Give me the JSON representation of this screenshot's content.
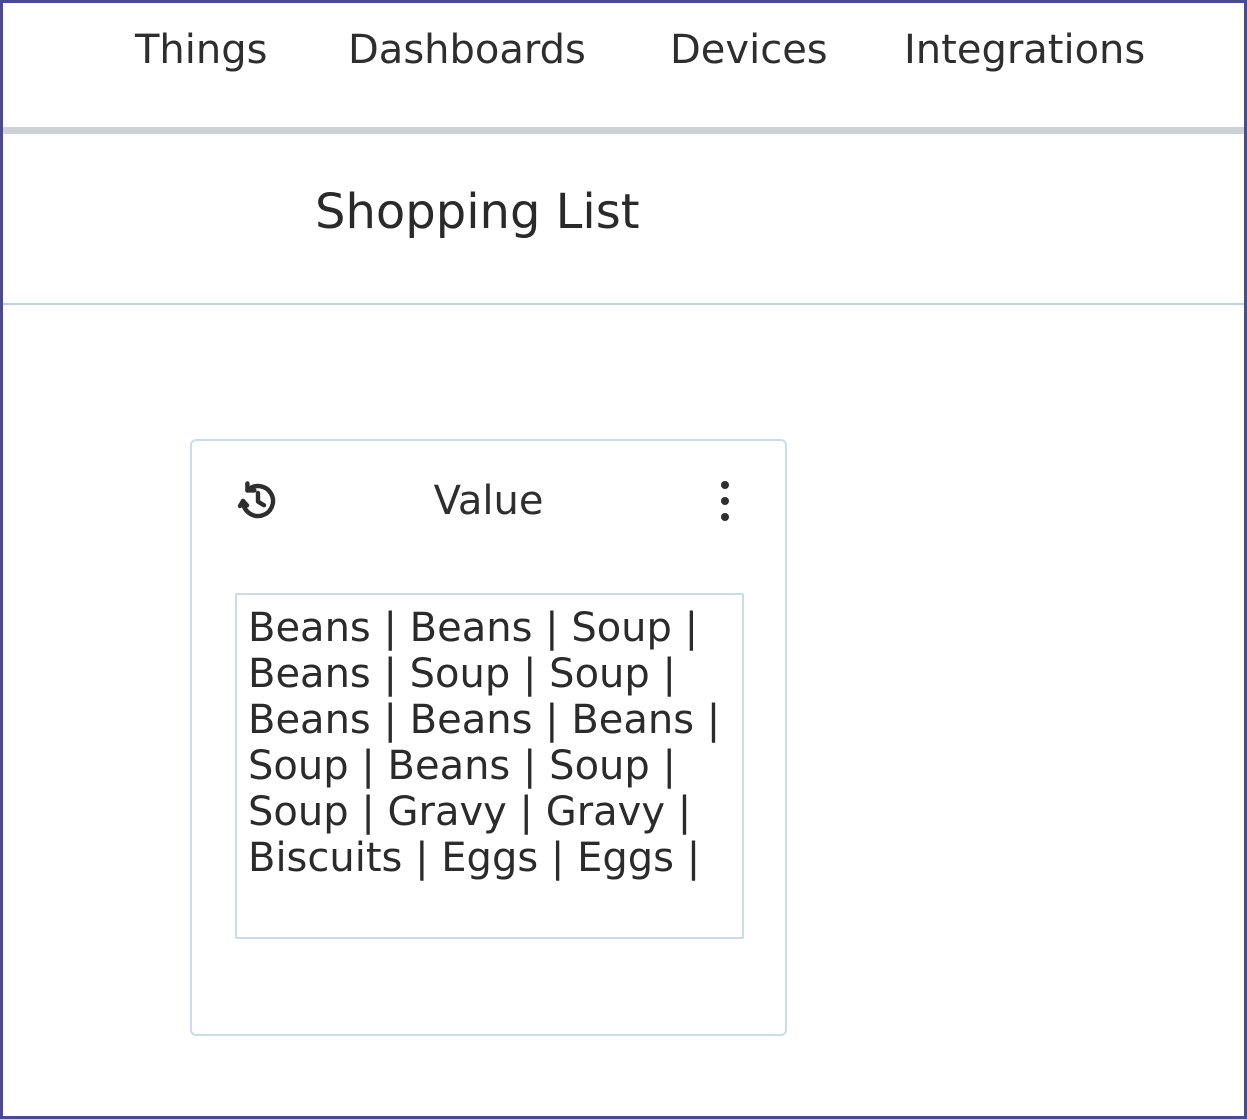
{
  "nav": {
    "items": [
      {
        "label": "Things"
      },
      {
        "label": "Dashboards"
      },
      {
        "label": "Devices"
      },
      {
        "label": "Integrations"
      }
    ]
  },
  "page": {
    "title": "Shopping List"
  },
  "widget": {
    "title": "Value",
    "history_icon": "history-icon",
    "menu_icon": "more-vertical-icon",
    "value_text": "Beans | Beans | Soup | Beans | Soup | Soup | Beans | Beans | Beans | Soup | Beans | Soup | Soup | Gravy | Gravy | Biscuits | Eggs | Eggs |"
  },
  "colors": {
    "frame_border": "#4b4a8c",
    "nav_divider": "#cdd2d6",
    "header_divider": "#bcd3dd",
    "card_border": "#c9dde4",
    "text": "#2b2b2b"
  }
}
